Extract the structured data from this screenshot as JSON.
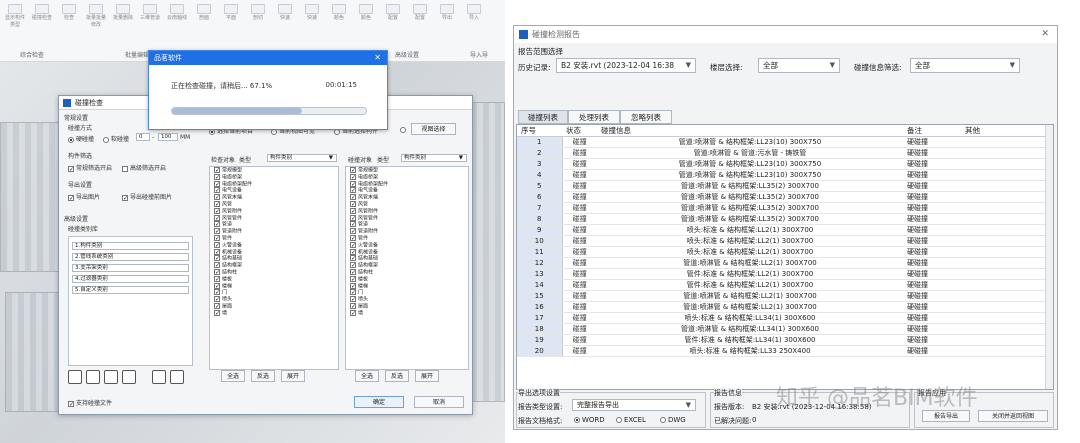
{
  "left": {
    "ribbon": {
      "items": [
        "显示构件类型",
        "碰撞检查",
        "检查",
        "批量批量修改",
        "批量删除",
        "三维管道",
        "云南轴线",
        "剖面",
        "平面",
        "剖切",
        "快速",
        "快速",
        "颜色",
        "颜色",
        "配置",
        "配置",
        "导出",
        "导入"
      ],
      "groups": [
        "综合检查",
        "批量编辑",
        "高级设置",
        "导入导"
      ]
    },
    "progress": {
      "title": "品茗软件",
      "message": "正在检查碰撞，请稍后... 67.1%",
      "time": "00:01:15",
      "percent": 67.1
    },
    "dialog": {
      "title": "碰撞检查",
      "general": "常规设置",
      "method_label": "碰撞方式",
      "hard": "硬碰撞",
      "soft": "软碰撞",
      "soft_min": "0",
      "soft_max": "100",
      "unit": "MM",
      "filter_label": "构件筛选",
      "filter_normal": "常规筛选开启",
      "filter_advanced": "高级筛选开启",
      "export_label": "导出设置",
      "export_img": "导出图片",
      "export_clash_img": "导出碰撞前图片",
      "advanced": "高级设置",
      "library": "碰撞类别库",
      "lib_items": [
        "1.构件类别",
        "2.管线系统类别",
        "3.支吊架类别",
        "4.过滤器类别",
        "5.自定义类别"
      ],
      "scope_options": [
        "选择当前项目",
        "当前视图可见",
        "当前选择构件"
      ],
      "scope_btn": "视图选择",
      "list1_header_a": "检查对象",
      "list1_header_b": "类型",
      "list1_select": "构件类别",
      "list2_header_a": "碰撞对象",
      "list2_header_b": "类型",
      "list2_select": "构件类别",
      "categories": [
        "常规模型",
        "电缆桥架",
        "电缆桥架配件",
        "电气设备",
        "风管末端",
        "风管",
        "风管附件",
        "风管管件",
        "管道",
        "管道附件",
        "管件",
        "火警设备",
        "机械设备",
        "结构基础",
        "结构框架",
        "结构柱",
        "楼板",
        "楼梯",
        "门",
        "喷头",
        "屋面",
        "墙"
      ],
      "btn_all": "全选",
      "btn_invert": "反选",
      "btn_expand": "展开",
      "support_file": "支持碰撞文件",
      "ok": "确定",
      "cancel": "取消"
    }
  },
  "report": {
    "title": "碰撞检测报告",
    "scope": "报告范围选择",
    "history_label": "历史记录:",
    "history_value": "B2 安装.rvt (2023-12-04 16:38",
    "floor_label": "楼层选择:",
    "floor_value": "全部",
    "info_label": "碰撞信息筛选:",
    "info_value": "全部",
    "tabs": [
      "碰撞列表",
      "处理列表",
      "忽略列表"
    ],
    "columns": [
      "序号",
      "状态",
      "碰撞信息",
      "备注",
      "其他"
    ],
    "rows": [
      [
        "1",
        "碰撞",
        "管道:喷淋管 & 结构框架:LL23(10) 300X750",
        "硬碰撞"
      ],
      [
        "2",
        "碰撞",
        "管道:喷淋管 & 管道:污水管 - 铸铁管",
        "硬碰撞"
      ],
      [
        "3",
        "碰撞",
        "管道:喷淋管 & 结构框架:LL23(10) 300X750",
        "硬碰撞"
      ],
      [
        "4",
        "碰撞",
        "管道:喷淋管 & 结构框架:LL23(10) 300X750",
        "硬碰撞"
      ],
      [
        "5",
        "碰撞",
        "管道:喷淋管 & 结构框架:LL35(2) 300X700",
        "硬碰撞"
      ],
      [
        "6",
        "碰撞",
        "管道:喷淋管 & 结构框架:LL35(2) 300X700",
        "硬碰撞"
      ],
      [
        "7",
        "碰撞",
        "管道:喷淋管 & 结构框架:LL35(2) 300X700",
        "硬碰撞"
      ],
      [
        "8",
        "碰撞",
        "管道:喷淋管 & 结构框架:LL35(2) 300X700",
        "硬碰撞"
      ],
      [
        "9",
        "碰撞",
        "喷头:标准 & 结构框架:LL2(1) 300X700",
        "硬碰撞"
      ],
      [
        "10",
        "碰撞",
        "喷头:标准 & 结构框架:LL2(1) 300X700",
        "硬碰撞"
      ],
      [
        "11",
        "碰撞",
        "喷头:标准 & 结构框架:LL2(1) 300X700",
        "硬碰撞"
      ],
      [
        "12",
        "碰撞",
        "管道:喷淋管 & 结构框架:LL2(1) 300X700",
        "硬碰撞"
      ],
      [
        "13",
        "碰撞",
        "管件:标准 & 结构框架:LL2(1) 300X700",
        "硬碰撞"
      ],
      [
        "14",
        "碰撞",
        "管件:标准 & 结构框架:LL2(1) 300X700",
        "硬碰撞"
      ],
      [
        "15",
        "碰撞",
        "管道:喷淋管 & 结构框架:LL2(1) 300X700",
        "硬碰撞"
      ],
      [
        "16",
        "碰撞",
        "管道:喷淋管 & 结构框架:LL2(1) 300X700",
        "硬碰撞"
      ],
      [
        "17",
        "碰撞",
        "喷头:标准 & 结构框架:LL34(1) 300X600",
        "硬碰撞"
      ],
      [
        "18",
        "碰撞",
        "管道:喷淋管 & 结构框架:LL34(1) 300X600",
        "硬碰撞"
      ],
      [
        "19",
        "碰撞",
        "管件:标准 & 结构框架:LL34(1) 300X600",
        "硬碰撞"
      ],
      [
        "20",
        "碰撞",
        "喷头:标准 & 结构框架:LL33 250X400",
        "硬碰撞"
      ]
    ],
    "export_group": "导出选项设置",
    "report_type_label": "报告类型设置:",
    "report_type_value": "完整报告导出",
    "report_format_label": "报告文档格式:",
    "formats": [
      "WORD",
      "EXCEL",
      "DWG"
    ],
    "info_group": "报告信息",
    "version_label": "报告版本:",
    "version_value": "B2 安装.rvt (2023-12-04 16:38:58)",
    "resolved_label": "已解决问题:",
    "resolved_value": "0",
    "apply_group": "报告应用",
    "btn_export": "报告导出",
    "btn_close": "关闭并返回视图",
    "watermark": "知乎 @品茗BIM软件"
  }
}
